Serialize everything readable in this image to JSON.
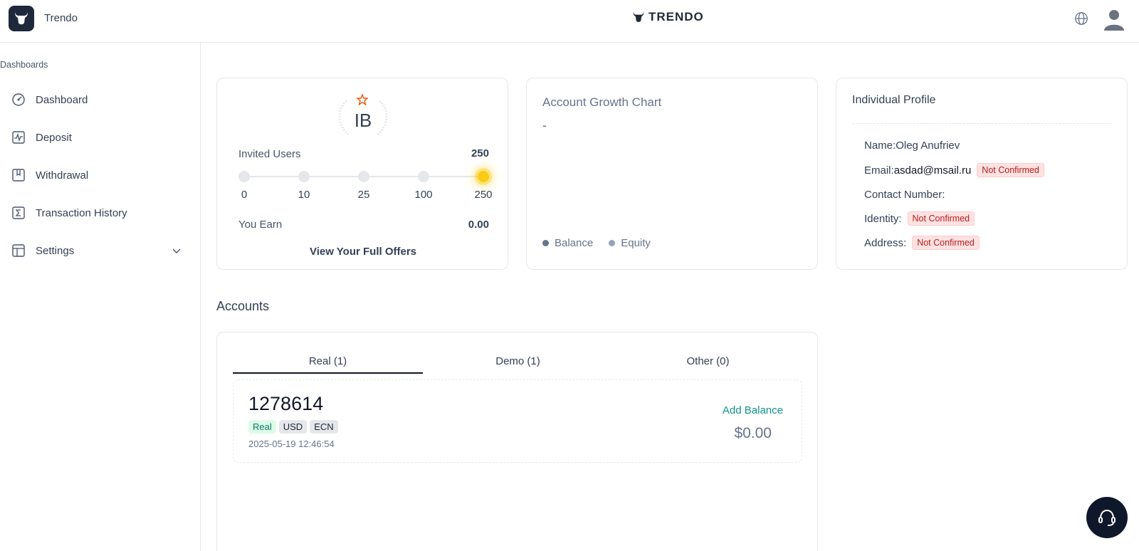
{
  "header": {
    "app_name": "Trendo",
    "brand": "TRENDO",
    "icons": [
      "bull-logo-icon",
      "globe-icon",
      "user-avatar-icon"
    ]
  },
  "sidebar": {
    "section_label": "Dashboards",
    "items": [
      {
        "label": "Dashboard",
        "icon": "gauge-icon"
      },
      {
        "label": "Deposit",
        "icon": "activity-icon"
      },
      {
        "label": "Withdrawal",
        "icon": "bookmark-icon"
      },
      {
        "label": "Transaction History",
        "icon": "sigma-icon"
      },
      {
        "label": "Settings",
        "icon": "table-icon",
        "has_dropdown": true
      }
    ]
  },
  "ib_card": {
    "badge": "IB",
    "invited_label": "Invited Users",
    "invited_value": "250",
    "steps": [
      "0",
      "10",
      "25",
      "100",
      "250"
    ],
    "active_step": "250",
    "earn_label": "You Earn",
    "earn_value": "0.00",
    "link_label": "View Your Full Offers"
  },
  "growth_card": {
    "title": "Account Growth Chart",
    "value": "-",
    "legend": [
      {
        "label": "Balance",
        "color": "#64748b"
      },
      {
        "label": "Equity",
        "color": "#94a3b8"
      }
    ]
  },
  "profile_card": {
    "title": "Individual Profile",
    "name_label": "Name:",
    "name_value": "Oleg Anufriev",
    "email_label": "Email:",
    "email_value": "asdad@msail.ru",
    "email_status": "Not Confirmed",
    "contact_label": "Contact Number:",
    "identity_label": "Identity:",
    "identity_status": "Not Confirmed",
    "address_label": "Address:",
    "address_status": "Not Confirmed"
  },
  "accounts": {
    "title": "Accounts",
    "tabs": [
      {
        "label": "Real (1)",
        "active": true
      },
      {
        "label": "Demo (1)",
        "active": false
      },
      {
        "label": "Other (0)",
        "active": false
      }
    ],
    "items": [
      {
        "number": "1278614",
        "tags": [
          "Real",
          "USD",
          "ECN"
        ],
        "created": "2025-05-19 12:46:54",
        "action_label": "Add Balance",
        "balance": "$0.00"
      }
    ]
  },
  "colors": {
    "accent": "#0d9488",
    "danger": "#b91c1c",
    "highlight": "#facc15",
    "dark": "#0f172a"
  }
}
